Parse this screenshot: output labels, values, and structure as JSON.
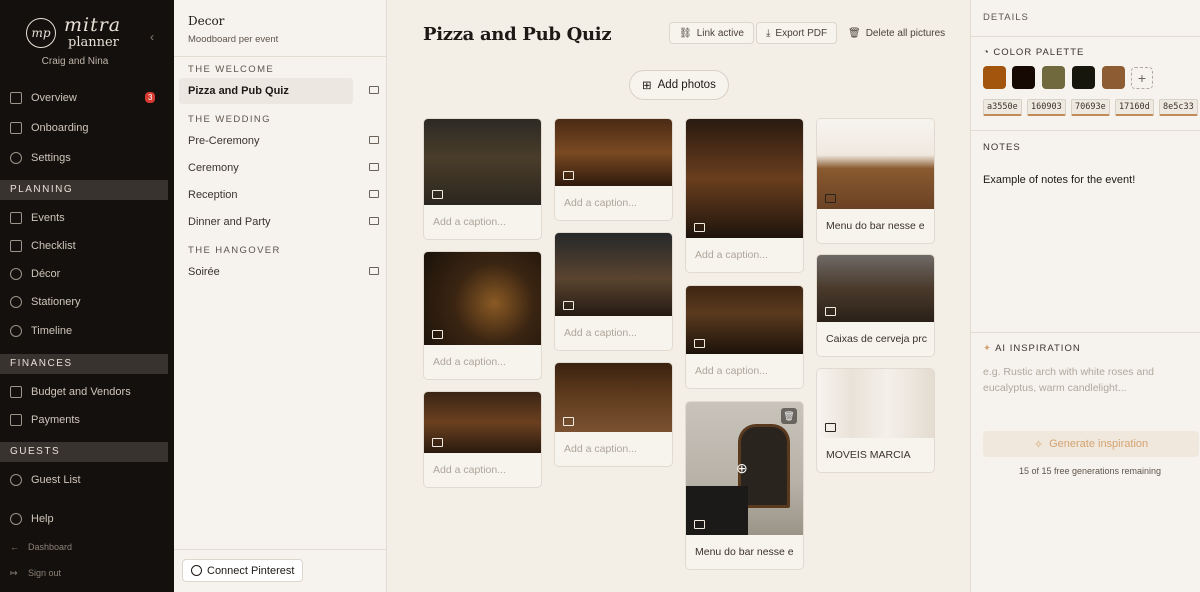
{
  "brand": {
    "line1": "mitra",
    "line2": "planner",
    "mark": "mp"
  },
  "couple": "Craig and Nina",
  "nav": {
    "overview": "Overview",
    "overview_badge": "3",
    "onboarding": "Onboarding",
    "settings": "Settings",
    "planning": "PLANNING",
    "events": "Events",
    "checklist": "Checklist",
    "decor": "Décor",
    "stationery": "Stationery",
    "timeline": "Timeline",
    "finances": "FINANCES",
    "budget": "Budget and Vendors",
    "payments": "Payments",
    "guests": "GUESTS",
    "guest_list": "Guest List",
    "help": "Help",
    "dashboard": "Dashboard",
    "sign_out": "Sign out"
  },
  "events_panel": {
    "title": "Decor",
    "subtitle": "Moodboard per event",
    "groups": [
      "THE WELCOME",
      "THE WEDDING",
      "THE HANGOVER"
    ],
    "items": [
      "Pizza and Pub Quiz",
      "Pre-Ceremony",
      "Ceremony",
      "Reception",
      "Dinner and Party",
      "Soirée"
    ],
    "connect_pinterest": "Connect Pinterest"
  },
  "main": {
    "title": "Pizza and Pub Quiz",
    "link_active": "Link active",
    "export_pdf": "Export PDF",
    "delete_all": "Delete all pictures",
    "add_photos": "Add photos",
    "placeholder": "Add a caption...",
    "captions": {
      "bar_menu": "Menu do bar nesse e",
      "beer_boxes": "Caixas de cerveja prc",
      "furniture": "MOVEIS MARCIA",
      "welcome_sign": "Menu do bar nesse e"
    }
  },
  "details": {
    "header": "DETAILS",
    "palette_label": "COLOR PALETTE",
    "palette": [
      "a3550e",
      "160903",
      "70693e",
      "17160d",
      "8e5c33"
    ],
    "notes_label": "NOTES",
    "notes": "Example of notes for the event!",
    "ai_label": "AI INSPIRATION",
    "ai_placeholder": "e.g. Rustic arch with white roses and eucalyptus, warm candlelight...",
    "generate": "Generate inspiration",
    "remaining": "15 of 15 free generations remaining"
  }
}
